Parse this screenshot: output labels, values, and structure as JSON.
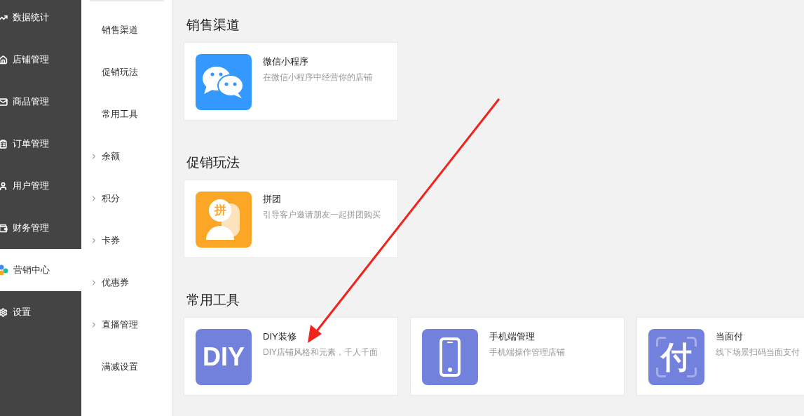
{
  "sidebar": {
    "items": [
      {
        "label": "数据统计",
        "kind": "chart",
        "selected": false
      },
      {
        "label": "店铺管理",
        "kind": "store",
        "selected": false
      },
      {
        "label": "商品管理",
        "kind": "bag",
        "selected": false
      },
      {
        "label": "订单管理",
        "kind": "list",
        "selected": false
      },
      {
        "label": "用户管理",
        "kind": "user",
        "selected": false
      },
      {
        "label": "财务管理",
        "kind": "money",
        "selected": false
      },
      {
        "label": "营销中心",
        "kind": "marketing",
        "selected": true
      },
      {
        "label": "设置",
        "kind": "gear",
        "selected": false
      }
    ]
  },
  "submenu": {
    "items": [
      {
        "label": "销售渠道",
        "expandable": false
      },
      {
        "label": "促销玩法",
        "expandable": false
      },
      {
        "label": "常用工具",
        "expandable": false
      },
      {
        "label": "余额",
        "expandable": true
      },
      {
        "label": "积分",
        "expandable": true
      },
      {
        "label": "卡券",
        "expandable": true
      },
      {
        "label": "优惠券",
        "expandable": true
      },
      {
        "label": "直播管理",
        "expandable": true
      },
      {
        "label": "满减设置",
        "expandable": false
      }
    ]
  },
  "sections": [
    {
      "title": "销售渠道",
      "cards": [
        {
          "title": "微信小程序",
          "description": "在微信小程序中经营你的店铺",
          "kind": "chat",
          "color": "#3399ff"
        }
      ]
    },
    {
      "title": "促销玩法",
      "cards": [
        {
          "title": "拼团",
          "description": "引导客户邀请朋友一起拼团购买",
          "kind": "group",
          "icon_text": "拼",
          "color": "#fca626"
        }
      ]
    },
    {
      "title": "常用工具",
      "cards": [
        {
          "title": "DIY装修",
          "description": "DIY店铺风格和元素，千人千面",
          "kind": "text",
          "icon_text": "DIY",
          "color": "#7282dc"
        },
        {
          "title": "手机端管理",
          "description": "手机端操作管理店铺",
          "kind": "phone",
          "color": "#7282dc"
        },
        {
          "title": "当面付",
          "description": "线下场景扫码当面支付",
          "kind": "scan",
          "icon_text": "付",
          "color": "#7282dc"
        }
      ]
    }
  ]
}
